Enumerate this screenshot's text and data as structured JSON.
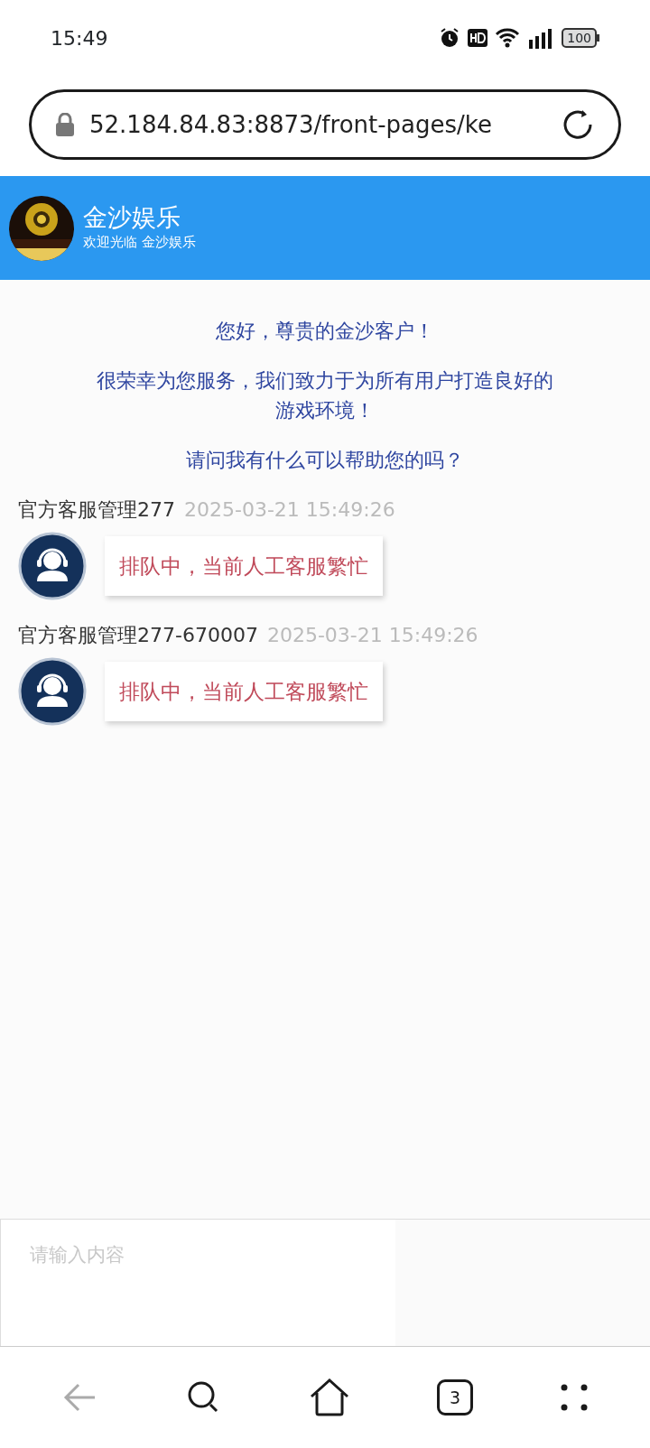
{
  "status_bar": {
    "time": "15:49",
    "battery": "100"
  },
  "browser": {
    "url": "52.184.84.83:8873/front-pages/ke"
  },
  "header": {
    "title": "金沙娱乐",
    "subtitle": "欢迎光临 金沙娱乐"
  },
  "greeting": [
    "您好，尊贵的金沙客户！",
    "很荣幸为您服务，我们致力于为所有用户打造良好的游戏环境！",
    "请问我有什么可以帮助您的吗？"
  ],
  "messages": [
    {
      "sender": "官方客服管理277",
      "time": "2025-03-21 15:49:26",
      "text": "排队中，当前人工客服繁忙"
    },
    {
      "sender": "官方客服管理277-670007",
      "time": "2025-03-21 15:49:26",
      "text": "排队中，当前人工客服繁忙"
    }
  ],
  "composer": {
    "placeholder": "请输入内容"
  },
  "nav": [
    {
      "kind": "back",
      "disabled": true
    },
    {
      "kind": "search",
      "disabled": false
    },
    {
      "kind": "home",
      "disabled": false
    },
    {
      "kind": "tabs",
      "count": "3",
      "disabled": false
    },
    {
      "kind": "menu",
      "disabled": false
    }
  ]
}
